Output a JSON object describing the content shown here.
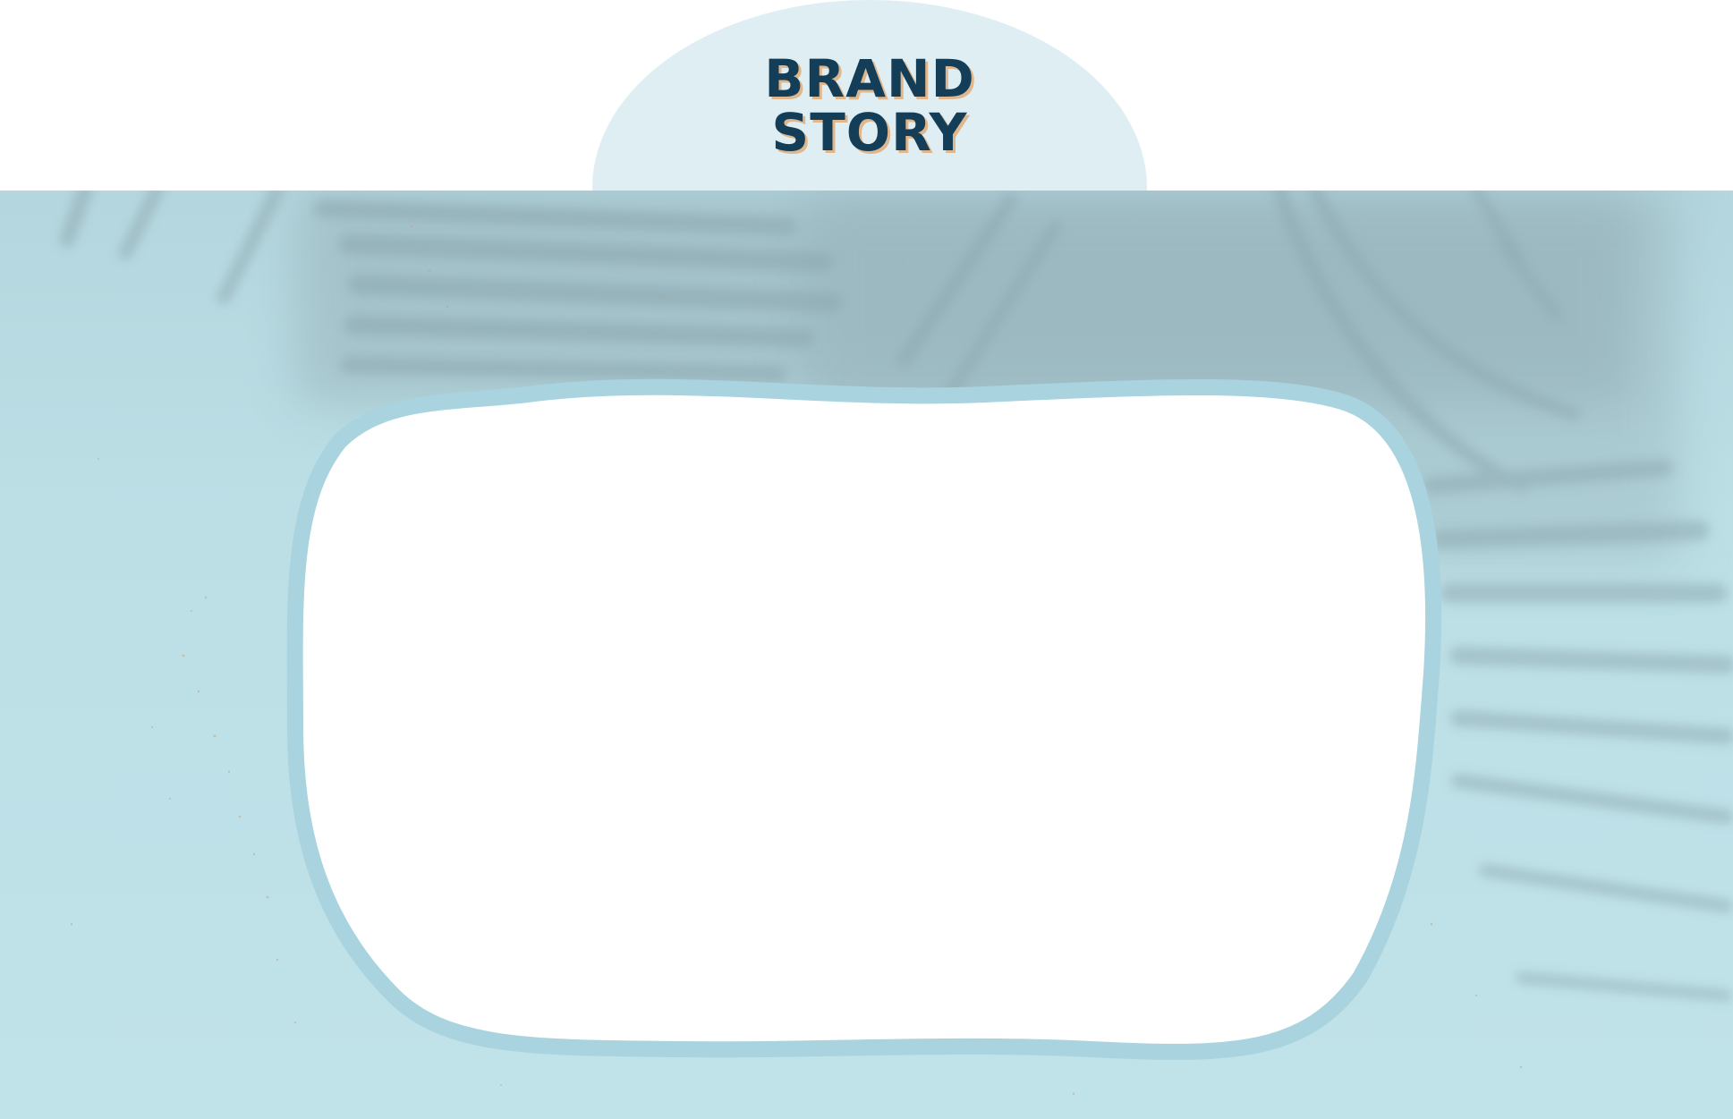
{
  "title": {
    "line1": "BRAND",
    "line2": "STORY"
  },
  "colors": {
    "title_text": "#143d58",
    "title_shadow": "#e0b78c",
    "header_oval": "#deeef3",
    "panel_background": "#bcdfe6",
    "frame_border": "#a9d3de",
    "frame_fill": "#ffffff"
  }
}
